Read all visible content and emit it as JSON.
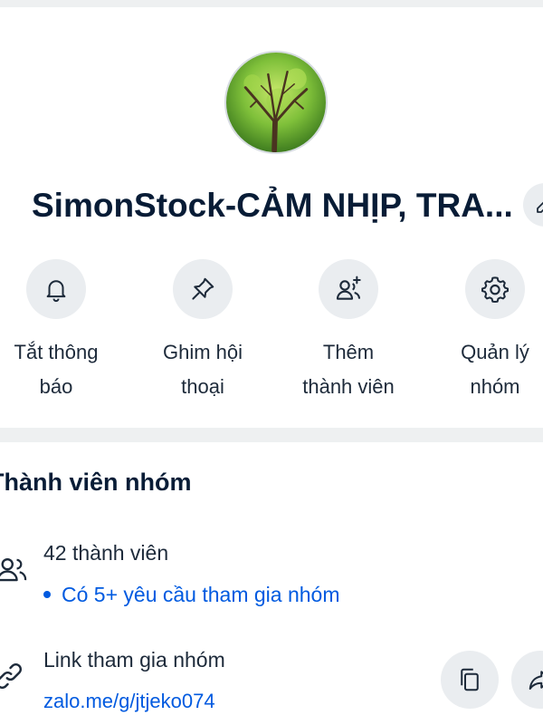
{
  "group": {
    "name": "SimonStock-CẢM NHỊP, TRA...",
    "avatar_icon": "tree-photo-avatar",
    "edit_icon": "pencil-icon"
  },
  "actions": [
    {
      "icon": "bell-icon",
      "line1": "Tắt thông",
      "line2": "báo"
    },
    {
      "icon": "pin-icon",
      "line1": "Ghim hội",
      "line2": "thoại"
    },
    {
      "icon": "add-member-icon",
      "line1": "Thêm",
      "line2": "thành viên"
    },
    {
      "icon": "gear-icon",
      "line1": "Quản lý",
      "line2": "nhóm"
    }
  ],
  "members_section": {
    "title": "Thành viên nhóm",
    "count_text": "42 thành viên",
    "requests_text": "Có 5+ yêu cầu tham gia nhóm"
  },
  "invite_link": {
    "title": "Link tham gia nhóm",
    "url": "zalo.me/g/jtjeko074",
    "copy_icon": "copy-icon",
    "share_icon": "share-icon"
  },
  "colors": {
    "accent": "#005ae0",
    "text": "#081c36",
    "button_bg": "#eaedf0",
    "divider": "#eef0f1"
  }
}
